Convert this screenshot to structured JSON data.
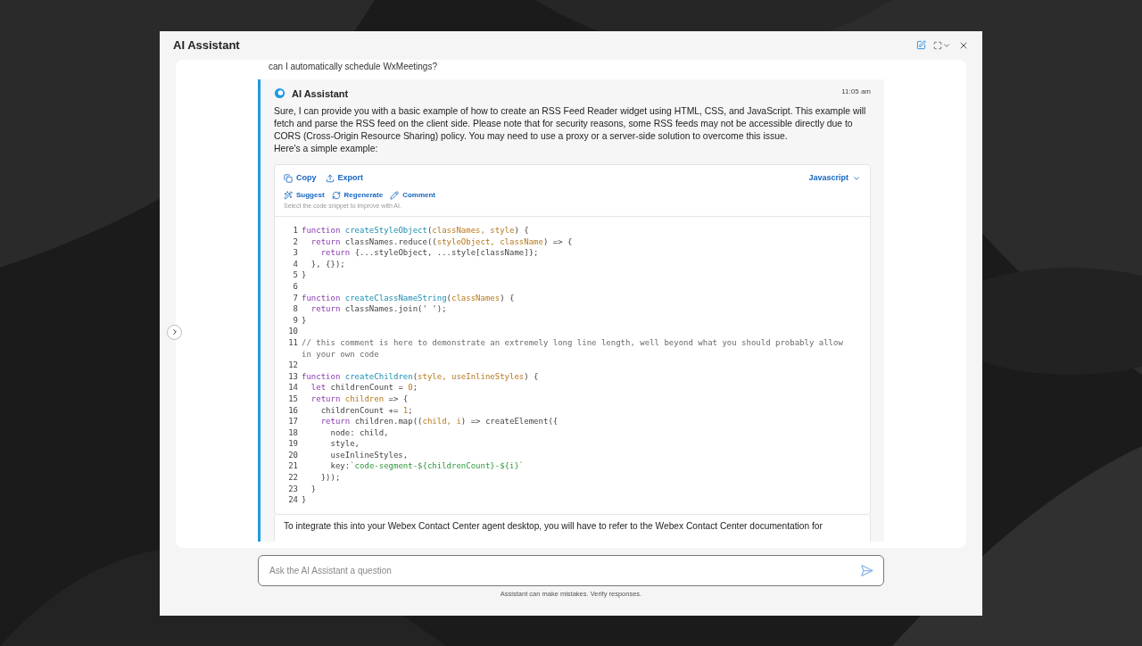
{
  "window": {
    "title": "AI Assistant"
  },
  "previous_message": "can I automatically schedule WxMeetings?",
  "message": {
    "sender": "AI Assistant",
    "time": "11:05 am",
    "intro": "Sure, I can provide you with a basic example of how to create an RSS Feed Reader widget using HTML, CSS, and JavaScript. This example will fetch and parse the RSS feed on the client side. Please note that for security reasons, some RSS feeds may not be accessible directly due to CORS (Cross-Origin Resource Sharing) policy. You may need to use a proxy or a server-side solution to overcome this issue.",
    "intro_2": "Here's a simple example:",
    "code_toolbar": {
      "actions": [
        {
          "kind": "copy",
          "label": "Copy"
        },
        {
          "kind": "export",
          "label": "Export"
        }
      ],
      "ai_actions": [
        {
          "kind": "suggest",
          "label": "Suggest"
        },
        {
          "kind": "regenerate",
          "label": "Regenerate"
        },
        {
          "kind": "comment",
          "label": "Comment"
        }
      ],
      "hint": "Select the code snippet to improve with AI.",
      "language": "Javascript"
    },
    "code_lines": [
      {
        "number": "1",
        "tokens": [
          {
            "kind": "keyword",
            "text": "function "
          },
          {
            "kind": "function",
            "text": "createStyleObject"
          },
          {
            "kind": "plain",
            "text": "("
          },
          {
            "kind": "param",
            "text": "classNames, style"
          },
          {
            "kind": "plain",
            "text": ") {"
          }
        ]
      },
      {
        "number": "2",
        "tokens": [
          {
            "kind": "keyword",
            "text": "  return "
          },
          {
            "kind": "plain",
            "text": "classNames.reduce(("
          },
          {
            "kind": "param",
            "text": "styleObject, className"
          },
          {
            "kind": "plain",
            "text": ") => {"
          }
        ]
      },
      {
        "number": "3",
        "tokens": [
          {
            "kind": "keyword",
            "text": "    return "
          },
          {
            "kind": "plain",
            "text": "{...styleObject, ...style[className]};"
          }
        ]
      },
      {
        "number": "4",
        "tokens": [
          {
            "kind": "plain",
            "text": "  }, {});"
          }
        ]
      },
      {
        "number": "5",
        "tokens": [
          {
            "kind": "plain",
            "text": "}"
          }
        ]
      },
      {
        "number": "6"
      },
      {
        "number": "7",
        "tokens": [
          {
            "kind": "keyword",
            "text": "function "
          },
          {
            "kind": "function",
            "text": "createClassNameString"
          },
          {
            "kind": "plain",
            "text": "("
          },
          {
            "kind": "param",
            "text": "classNames"
          },
          {
            "kind": "plain",
            "text": ") {"
          }
        ]
      },
      {
        "number": "8",
        "tokens": [
          {
            "kind": "keyword",
            "text": "  return "
          },
          {
            "kind": "plain",
            "text": "classNames.join(' ');"
          }
        ]
      },
      {
        "number": "9",
        "tokens": [
          {
            "kind": "plain",
            "text": "}"
          }
        ]
      },
      {
        "number": "10"
      },
      {
        "number": "11",
        "tokens": [
          {
            "kind": "comment",
            "text": "// this comment is here to demonstrate an extremely long line length, well beyond what you should probably allow in your own code"
          }
        ]
      },
      {
        "number": "12"
      },
      {
        "number": "13",
        "tokens": [
          {
            "kind": "keyword",
            "text": "function "
          },
          {
            "kind": "function",
            "text": "createChildren"
          },
          {
            "kind": "plain",
            "text": "("
          },
          {
            "kind": "param",
            "text": "style, useInlineStyles"
          },
          {
            "kind": "plain",
            "text": ") {"
          }
        ]
      },
      {
        "number": "14",
        "tokens": [
          {
            "kind": "keyword",
            "text": "  let "
          },
          {
            "kind": "plain",
            "text": "childrenCount = "
          },
          {
            "kind": "number",
            "text": "0"
          },
          {
            "kind": "plain",
            "text": ";"
          }
        ]
      },
      {
        "number": "15",
        "tokens": [
          {
            "kind": "keyword",
            "text": "  return "
          },
          {
            "kind": "param",
            "text": "children"
          },
          {
            "kind": "plain",
            "text": " => {"
          }
        ]
      },
      {
        "number": "16",
        "tokens": [
          {
            "kind": "plain",
            "text": "    childrenCount += "
          },
          {
            "kind": "number",
            "text": "1"
          },
          {
            "kind": "plain",
            "text": ";"
          }
        ]
      },
      {
        "number": "17",
        "tokens": [
          {
            "kind": "keyword",
            "text": "    return "
          },
          {
            "kind": "plain",
            "text": "children.map(("
          },
          {
            "kind": "param",
            "text": "child, i"
          },
          {
            "kind": "plain",
            "text": ") => createElement({"
          }
        ]
      },
      {
        "number": "18",
        "tokens": [
          {
            "kind": "plain",
            "text": "      node: child,"
          }
        ]
      },
      {
        "number": "19",
        "tokens": [
          {
            "kind": "plain",
            "text": "      style,"
          }
        ]
      },
      {
        "number": "20",
        "tokens": [
          {
            "kind": "plain",
            "text": "      useInlineStyles,"
          }
        ]
      },
      {
        "number": "21",
        "tokens": [
          {
            "kind": "plain",
            "text": "      key:"
          },
          {
            "kind": "string",
            "text": "`code-segment-${childrenCount}-${i}`"
          }
        ]
      },
      {
        "number": "22",
        "tokens": [
          {
            "kind": "plain",
            "text": "    }));"
          }
        ]
      },
      {
        "number": "23",
        "tokens": [
          {
            "kind": "plain",
            "text": "  }"
          }
        ]
      },
      {
        "number": "24",
        "tokens": [
          {
            "kind": "plain",
            "text": "}"
          }
        ]
      }
    ],
    "outro": "To integrate this into your Webex Contact Center agent desktop, you will have to refer to the Webex Contact Center documentation for"
  },
  "input": {
    "placeholder": "Ask the AI Assistant a question"
  },
  "disclaimer": "Assistant can make mistakes. Verify responses."
}
